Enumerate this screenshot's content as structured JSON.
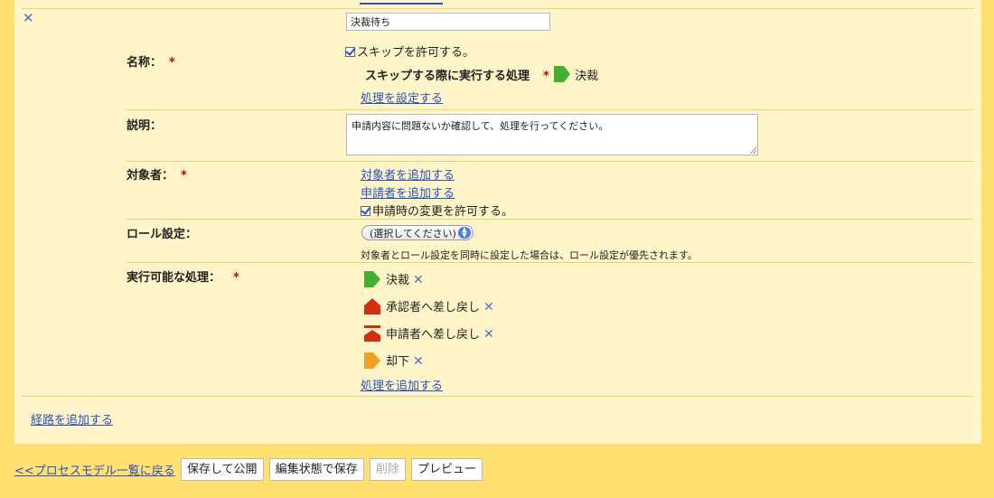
{
  "form": {
    "name": {
      "label": "名称：",
      "required": "*",
      "value": "決裁待ち",
      "allow_skip": "スキップを許可する。",
      "skip_action_label": "スキップする際に実行する処理",
      "skip_action_value": "決裁",
      "set_action_link": "処理を設定する"
    },
    "description": {
      "label": "説明：",
      "value": "申請内容に問題ないか確認して、処理を行ってください。"
    },
    "target": {
      "label": "対象者：",
      "required": "*",
      "add_target_link": "対象者を追加する",
      "add_applicant_link": "申請者を追加する",
      "allow_change": "申請時の変更を許可する。"
    },
    "role": {
      "label": "ロール設定：",
      "select_value": "(選択してください)",
      "note": "対象者とロール設定を同時に設定した場合は、ロール設定が優先されます。"
    },
    "actions": {
      "label": "実行可能な処理：",
      "required": "*",
      "items": [
        {
          "label": "決裁",
          "icon": "green-arrow-icon",
          "color": "#44b030"
        },
        {
          "label": "承認者へ差し戻し",
          "icon": "red-house-icon",
          "color": "#d03010"
        },
        {
          "label": "申請者へ差し戻し",
          "icon": "red-house-bar-icon",
          "color": "#d03010"
        },
        {
          "label": "却下",
          "icon": "orange-arrow-icon",
          "color": "#f0a020"
        }
      ],
      "add_action_link": "処理を追加する"
    }
  },
  "add_route_link": "経路を追加する",
  "footer": {
    "back_link": "<<プロセスモデル一覧に戻る",
    "save_publish": "保存して公開",
    "save_edit": "編集状態で保存",
    "delete": "削除",
    "preview": "プレビュー"
  }
}
